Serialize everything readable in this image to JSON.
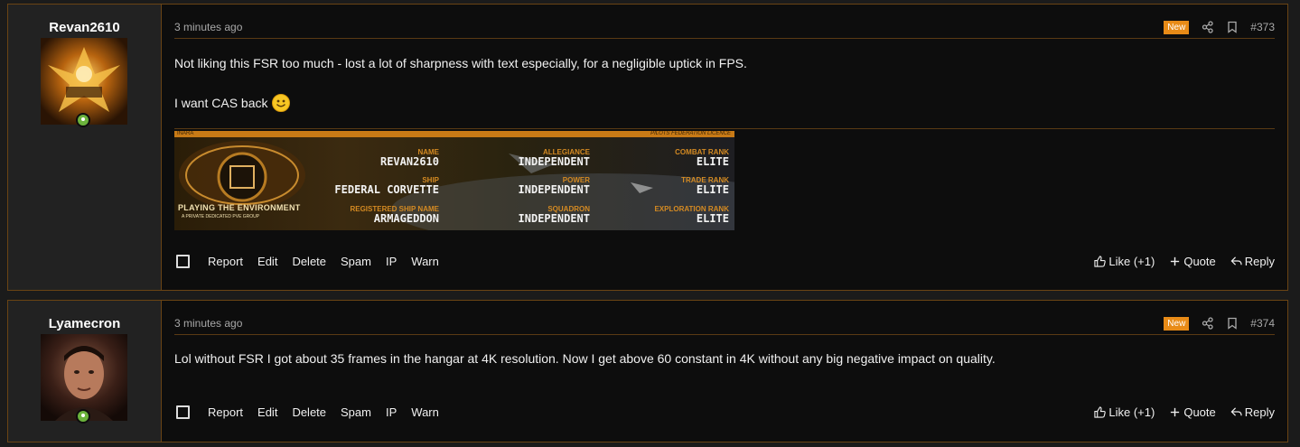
{
  "posts": [
    {
      "username": "Revan2610",
      "date": "3 minutes ago",
      "badge": "New",
      "number": "#373",
      "lines": [
        "Not liking this FSR too much - lost a lot of sharpness with text especially, for a negligible uptick in FPS.",
        "I want CAS back"
      ],
      "signature": {
        "top_left": "INARA",
        "top_right": "PILOTS FEDERATION LICENCE",
        "logo_text": "PLAYING THE ENVIRONMENT",
        "logo_sub": "A PRIVATE DEDICATED PVE GROUP",
        "fields": [
          {
            "label": "NAME",
            "value": "REVAN2610"
          },
          {
            "label": "ALLEGIANCE",
            "value": "INDEPENDENT"
          },
          {
            "label": "COMBAT RANK",
            "value": "ELITE"
          },
          {
            "label": "SHIP",
            "value": "FEDERAL CORVETTE"
          },
          {
            "label": "POWER",
            "value": "INDEPENDENT"
          },
          {
            "label": "TRADE RANK",
            "value": "ELITE"
          },
          {
            "label": "REGISTERED SHIP NAME",
            "value": "ARMAGEDDON"
          },
          {
            "label": "SQUADRON",
            "value": "INDEPENDENT"
          },
          {
            "label": "EXPLORATION RANK",
            "value": "ELITE"
          }
        ]
      }
    },
    {
      "username": "Lyamecron",
      "date": "3 minutes ago",
      "badge": "New",
      "number": "#374",
      "lines": [
        "Lol without FSR I got about 35 frames in the hangar at 4K resolution. Now I get above 60 constant in 4K without any big negative impact on quality."
      ]
    }
  ],
  "actions": {
    "left": [
      "Report",
      "Edit",
      "Delete",
      "Spam",
      "IP",
      "Warn"
    ],
    "like": "Like (+1)",
    "quote": "Quote",
    "reply": "Reply"
  },
  "colors": {
    "accent": "#e88b17",
    "border": "#6a4414",
    "online": "#6bb33c"
  },
  "icons": [
    "share-icon",
    "bookmark-icon",
    "thumbs-up-icon",
    "plus-icon",
    "reply-icon",
    "smiley-icon",
    "online-status-icon"
  ]
}
